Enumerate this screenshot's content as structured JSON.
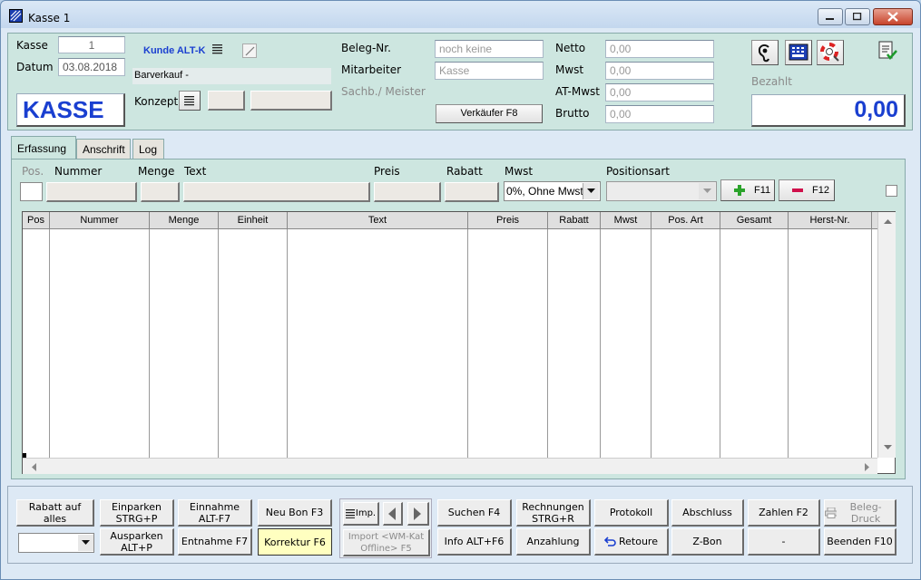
{
  "window": {
    "title": "Kasse 1"
  },
  "header": {
    "kasse_label": "Kasse",
    "kasse_value": "1",
    "datum_label": "Datum",
    "datum_value": "03.08.2018",
    "mode_banner": "KASSE",
    "kunde_label": "Kunde ALT-K",
    "barverkauf": "Barverkauf -",
    "konzept_label": "Konzept",
    "beleg_label": "Beleg-Nr.",
    "beleg_value": "noch keine",
    "mitarbeiter_label": "Mitarbeiter",
    "mitarbeiter_value": "Kasse",
    "sachb_label": "Sachb./ Meister",
    "verkaeufer_button": "Verkäufer F8",
    "netto_label": "Netto",
    "netto_value": "0,00",
    "mwst_label": "Mwst",
    "mwst_value": "0,00",
    "atmwst_label": "AT-Mwst",
    "atmwst_value": "0,00",
    "brutto_label": "Brutto",
    "brutto_value": "0,00",
    "bezahlt_label": "Bezahlt",
    "bezahlt_value": "0,00"
  },
  "tabs": [
    {
      "label": "Erfassung"
    },
    {
      "label": "Anschrift"
    },
    {
      "label": "Log"
    }
  ],
  "entry": {
    "pos_label": "Pos.",
    "nummer_label": "Nummer",
    "menge_label": "Menge",
    "text_label": "Text",
    "preis_label": "Preis",
    "rabatt_label": "Rabatt",
    "mwst_label": "Mwst",
    "mwst_value": "0%, Ohne Mwst",
    "positionsart_label": "Positionsart",
    "add_button": "F11",
    "remove_button": "F12"
  },
  "grid": {
    "columns": [
      "Pos",
      "Nummer",
      "Menge",
      "Einheit",
      "Text",
      "Preis",
      "Rabatt",
      "Mwst",
      "Pos. Art",
      "Gesamt",
      "Herst-Nr."
    ]
  },
  "footer": {
    "rabatt_alles": "Rabatt auf alles",
    "einparken": "Einparken\nSTRG+P",
    "ausparken": "Ausparken\nALT+P",
    "einnahme": "Einnahme\nALT-F7",
    "entnahme": "Entnahme F7",
    "neu_bon": "Neu Bon F3",
    "korrektur": "Korrektur F6",
    "imp": "Imp.",
    "import_offline": "Import <WM-Kat\nOffline> F5",
    "suchen": "Suchen F4",
    "info": "Info ALT+F6",
    "rechnungen": "Rechnungen\nSTRG+R",
    "anzahlung": "Anzahlung",
    "protokoll": "Protokoll",
    "retoure": "Retoure",
    "abschluss": "Abschluss",
    "zbon": "Z-Bon",
    "zahlen": "Zahlen F2",
    "dash": "-",
    "beleg_druck": "Beleg-Druck",
    "beenden": "Beenden F10"
  },
  "colors": {
    "accent_blue": "#1a3fd0",
    "panel_green": "#cde6e0",
    "highlight_yellow": "#ffffc0"
  }
}
